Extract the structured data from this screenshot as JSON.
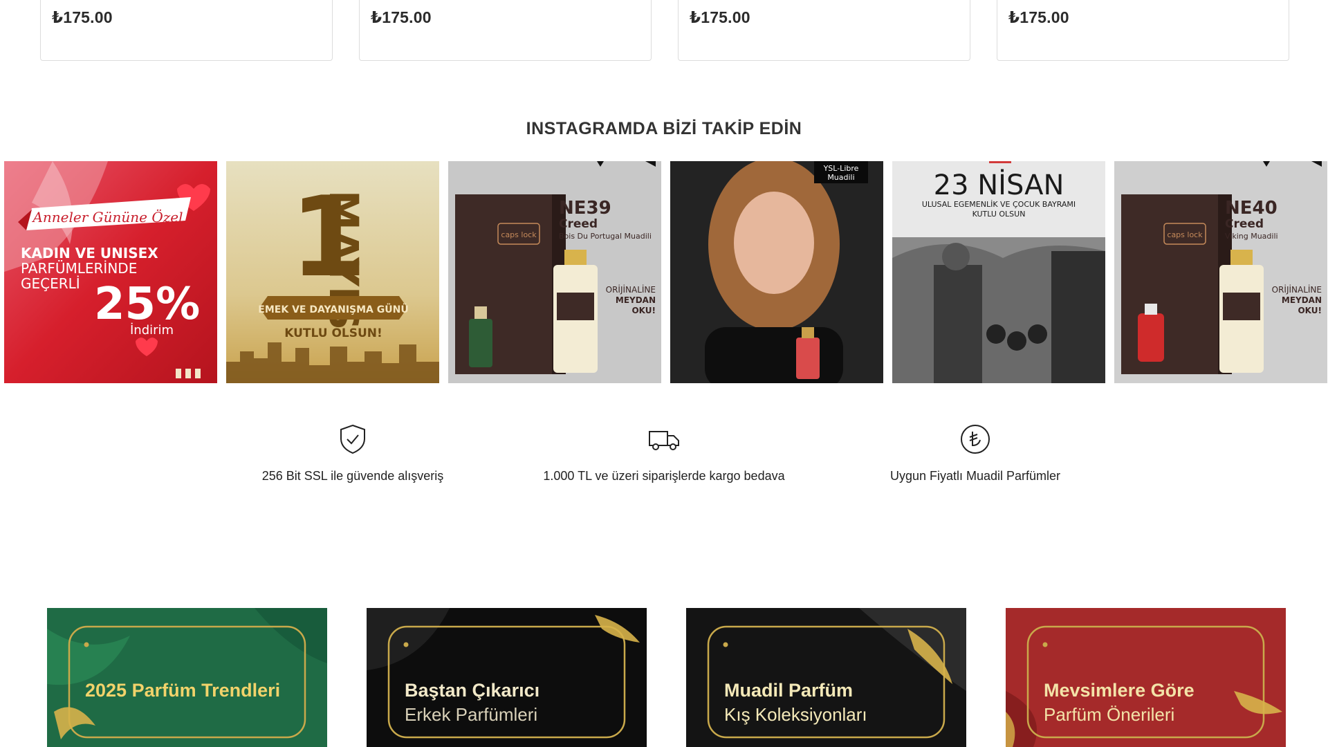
{
  "products": {
    "prices": [
      "₺175.00",
      "₺175.00",
      "₺175.00",
      "₺175.00"
    ]
  },
  "instagram": {
    "title": "INSTAGRAMDA BİZİ TAKİP EDİN",
    "posts": [
      {
        "script": "Anneler Gününe Özel",
        "line1": "KADIN VE UNISEX",
        "line2": "PARFÜMLERİNDE",
        "line3": "GEÇERLİ",
        "percent": "25%",
        "sub": "İndirim"
      },
      {
        "big": "1",
        "vertical": "MAYIS",
        "ribbon": "EMEK VE DAYANIŞMA GÜNÜ",
        "sub": "KUTLU OLSUN!"
      },
      {
        "code": "NE39",
        "brand": "Creed",
        "desc": "Bois Du Portugal Muadili",
        "box_label": "caps lock",
        "side1": "ORİJİNALİNE",
        "side2": "MEYDAN",
        "side3": "OKU!"
      },
      {
        "tag1": "YSL-Libre",
        "tag2": "Muadili"
      },
      {
        "big": "23 NİSAN",
        "line1": "ULUSAL EGEMENLİK VE ÇOCUK BAYRAMI",
        "line2": "KUTLU OLSUN"
      },
      {
        "code": "NE40",
        "brand": "Creed",
        "desc": "Viking Muadili",
        "box_label": "caps lock",
        "side1": "ORİJİNALİNE",
        "side2": "MEYDAN",
        "side3": "OKU!"
      }
    ]
  },
  "features": [
    {
      "icon": "shield-check-icon",
      "text": "256 Bit SSL ile güvende alışveriş"
    },
    {
      "icon": "truck-icon",
      "text": "1.000 TL ve üzeri siparişlerde kargo bedava"
    },
    {
      "icon": "lira-icon",
      "text": "Uygun Fiyatlı Muadil Parfümler"
    }
  ],
  "banners": [
    {
      "line1": "2025 Parfüm Trendleri",
      "line2": "",
      "bg": "#1f6b45",
      "text_color": "#f2d36b"
    },
    {
      "line1": "Baştan Çıkarıcı",
      "line2": "Erkek Parfümleri",
      "bg": "#0d0d0d",
      "text_color": "#f2e9c9"
    },
    {
      "line1": "Muadil Parfüm",
      "line2": "Kış Koleksiyonları",
      "bg": "#141414",
      "text_color": "#f4e9b8"
    },
    {
      "line1": "Mevsimlere Göre",
      "line2": "Parfüm Önerileri",
      "bg": "#a52a2a",
      "text_color": "#f3e3a8"
    }
  ],
  "colors": {
    "gold": "#c9a94b",
    "text": "#222222",
    "border": "#dcdcdc"
  }
}
